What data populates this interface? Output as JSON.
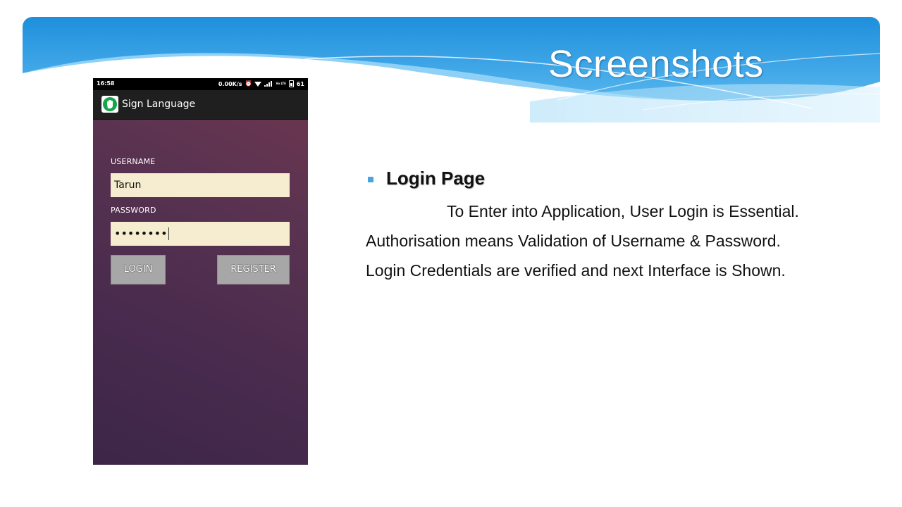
{
  "slide": {
    "title": "Screenshots",
    "heading": "Login Page",
    "lines": [
      "To Enter into Application, User Login is Essential.",
      "Authorisation means Validation of Username & Password.",
      "Login Credentials are verified and next Interface is Shown."
    ]
  },
  "phone": {
    "status_time": "16:58",
    "status_speed": "0.00K/s",
    "status_volte": "Vo LTE",
    "status_battery": "61",
    "app_title": "Sign Language",
    "username_label": "USERNAME",
    "username_value": "Tarun",
    "password_label": "PASSWORD",
    "password_value": "••••••••",
    "login_button": "LOGIN",
    "register_button": "REGISTER"
  },
  "icons": {
    "app": "hand-icon",
    "status": [
      "alarm-icon",
      "wifi-icon",
      "signal-icon",
      "battery-icon"
    ]
  },
  "colors": {
    "banner_blue": "#3ca6e6",
    "input_background": "#f6eccf",
    "button_gray": "#a7a7a7",
    "bullet_blue": "#4aa3df"
  }
}
